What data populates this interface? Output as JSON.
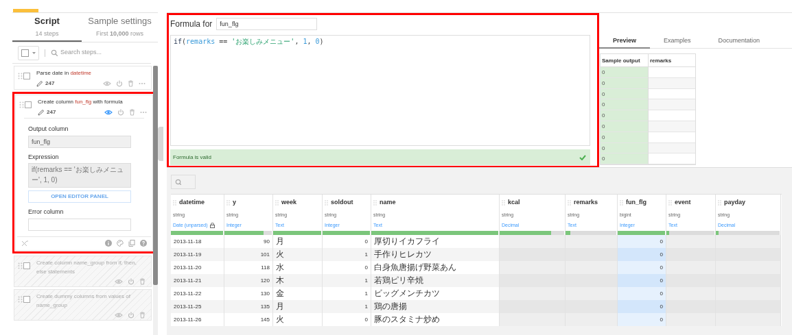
{
  "script_panel": {
    "tabs": [
      {
        "label": "Script",
        "caption": "14 steps",
        "selected": true
      },
      {
        "label": "Sample settings",
        "caption": "First **10,000** rows",
        "selected": false
      }
    ],
    "search": {
      "placeholder": "Search steps..."
    },
    "steps": [
      {
        "title": [
          {
            "text": "Parse date in "
          },
          {
            "text": "datetime",
            "kind": "column"
          }
        ],
        "count": "247",
        "enabled": true,
        "expanded": false,
        "checked": false
      },
      {
        "title": [
          {
            "text": "Create column "
          },
          {
            "text": "fun_flg",
            "kind": "column"
          },
          {
            "text": " with formula"
          }
        ],
        "count": "247",
        "enabled": true,
        "expanded": true,
        "checked": false,
        "form": [
          {
            "kind": "input",
            "label": "Output column",
            "value": "fun_flg"
          },
          {
            "kind": "textarea",
            "label": "Expression",
            "value": "if(remarks == 'お楽しみメニュー', 1, 0)"
          },
          {
            "kind": "button",
            "label": "OPEN EDITOR PANEL"
          },
          {
            "kind": "input",
            "label": "Error column"
          }
        ]
      },
      {
        "title": [
          {
            "text": "Create column name_group from if, then, else statements"
          }
        ],
        "enabled": false,
        "expanded": false,
        "checked": false
      },
      {
        "title": [
          {
            "text": "Create dummy columns from values of name_group"
          }
        ],
        "enabled": false,
        "expanded": false,
        "checked": false
      }
    ]
  },
  "formula": {
    "label": "Formula for",
    "column": "fun_flg",
    "code": [
      {
        "text": "if",
        "kind": "keyword"
      },
      {
        "text": "(",
        "kind": "punct"
      },
      {
        "text": "remarks",
        "kind": "column"
      },
      {
        "text": " == ",
        "kind": "punct"
      },
      {
        "text": "'お楽しみメニュー'",
        "kind": "string"
      },
      {
        "text": ", ",
        "kind": "punct"
      },
      {
        "text": "1",
        "kind": "number"
      },
      {
        "text": ", ",
        "kind": "punct"
      },
      {
        "text": "0",
        "kind": "number"
      },
      {
        "text": ")",
        "kind": "punct"
      }
    ],
    "status": "Formula is valid",
    "valid": true
  },
  "preview": {
    "tabs": [
      {
        "label": "Preview",
        "selected": true
      },
      {
        "label": "Examples",
        "selected": false
      },
      {
        "label": "Documentation",
        "selected": false
      }
    ],
    "columns": [
      "Sample output",
      "remarks"
    ],
    "rows": [
      "0",
      "0",
      "0",
      "0",
      "0",
      "0",
      "0",
      "0",
      "0"
    ]
  },
  "table": {
    "columns": [
      {
        "name": "datetime",
        "storage": "string",
        "meaning": "Date (unparsed)",
        "locked": true,
        "numeric": false,
        "selected": false,
        "level": 1
      },
      {
        "name": "y",
        "storage": "string",
        "meaning": "Integer",
        "locked": false,
        "numeric": true,
        "selected": false,
        "level": 0.83
      },
      {
        "name": "week",
        "storage": "string",
        "meaning": "Text",
        "locked": false,
        "numeric": false,
        "selected": false,
        "level": 1
      },
      {
        "name": "soldout",
        "storage": "string",
        "meaning": "Integer",
        "locked": false,
        "numeric": true,
        "selected": false,
        "level": 1
      },
      {
        "name": "name",
        "storage": "string",
        "meaning": "Text",
        "locked": false,
        "numeric": false,
        "selected": false,
        "level": 1
      },
      {
        "name": "kcal",
        "storage": "string",
        "meaning": "Decimal",
        "locked": false,
        "selected": false,
        "level": 0.8
      },
      {
        "name": "remarks",
        "storage": "string",
        "meaning": "Text",
        "locked": false,
        "selected": false,
        "level": 0.1
      },
      {
        "name": "fun_flg",
        "storage": "bigint",
        "meaning": "Integer",
        "locked": false,
        "numeric": true,
        "selected": true,
        "level": 1
      },
      {
        "name": "event",
        "storage": "string",
        "meaning": "Text",
        "locked": false,
        "selected": false,
        "level": 0.06
      },
      {
        "name": "payday",
        "storage": "string",
        "meaning": "Decimal",
        "locked": false,
        "selected": false,
        "level": 0.04
      }
    ],
    "rows": [
      [
        "2013-11-18",
        "90",
        "月",
        "0",
        "厚切りイカフライ",
        null,
        null,
        "0",
        null,
        null
      ],
      [
        "2013-11-19",
        "101",
        "火",
        "1",
        "手作りヒレカツ",
        null,
        null,
        "0",
        null,
        null
      ],
      [
        "2013-11-20",
        "118",
        "水",
        "0",
        "白身魚唐揚げ野菜あん",
        null,
        null,
        "0",
        null,
        null
      ],
      [
        "2013-11-21",
        "120",
        "木",
        "1",
        "若鶏ピリ辛焼",
        null,
        null,
        "0",
        null,
        null
      ],
      [
        "2013-11-22",
        "130",
        "金",
        "1",
        "ビッグメンチカツ",
        null,
        null,
        "0",
        null,
        null
      ],
      [
        "2013-11-25",
        "135",
        "月",
        "1",
        "鶏の唐揚",
        null,
        null,
        "0",
        null,
        null
      ],
      [
        "2013-11-26",
        "145",
        "火",
        "0",
        "豚のスタミナ炒め",
        null,
        null,
        "0",
        null,
        null
      ]
    ]
  }
}
